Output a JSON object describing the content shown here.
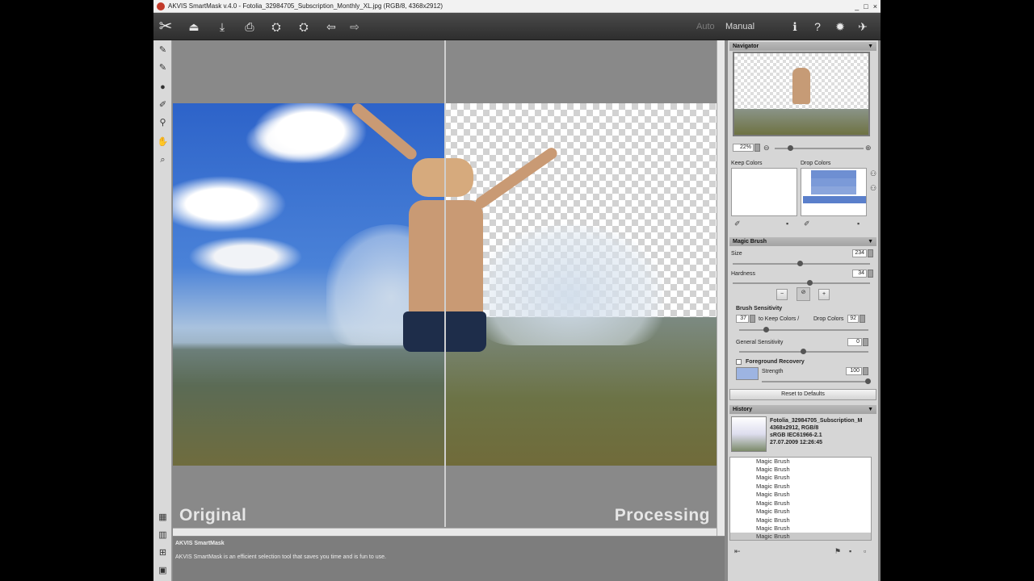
{
  "window": {
    "title": "AKVIS SmartMask v.4.0 - Fotolia_32984705_Subscription_Monthly_XL.jpg (RGB/8, 4368x2912)",
    "controls": [
      "_",
      "□",
      "×"
    ]
  },
  "toolbar": {
    "logo_glyph": "✂",
    "icons": [
      "open-icon",
      "save-icon",
      "print-icon",
      "share-icon",
      "batch-icon",
      "undo-icon",
      "redo-icon"
    ],
    "glyphs": [
      "⏏",
      "⤓",
      "⎙",
      "⛭",
      "⛭",
      "⇦",
      "⇨"
    ],
    "mode_auto": "Auto",
    "mode_manual": "Manual",
    "right_icons": [
      "info-icon",
      "help-icon",
      "settings-icon",
      "feedback-icon"
    ],
    "right_glyphs": [
      "ℹ",
      "?",
      "✹",
      "✈"
    ]
  },
  "left_tools": {
    "icons": [
      "magic-brush-icon",
      "chroma-brush-icon",
      "bucket-icon",
      "pipette-icon",
      "lasso-icon",
      "hand-icon",
      "zoom-icon",
      "view-mode-icon",
      "compare-icon",
      "fit-icon",
      "last-icon"
    ],
    "glyphs": [
      "✎",
      "✎",
      "●",
      "✐",
      "⚲",
      "✋",
      "⌕",
      "▦",
      "▥",
      "⊞",
      "▣"
    ]
  },
  "canvas": {
    "label_original": "Original",
    "label_processing": "Processing"
  },
  "info": {
    "title": "AKVIS SmartMask",
    "text": "AKVIS SmartMask is an efficient selection tool that saves you time and is fun to use."
  },
  "navigator": {
    "title": "Navigator",
    "zoom": "22%"
  },
  "colors": {
    "keep_label": "Keep Colors",
    "drop_label": "Drop Colors",
    "accent": "#6e8fd2"
  },
  "magic_brush": {
    "title": "Magic Brush",
    "size_label": "Size",
    "size_value": "234",
    "hardness_label": "Hardness",
    "hardness_value": "34",
    "sensitivity_title": "Brush Sensitivity",
    "keep_value": "37",
    "keep_label": "to Keep Colors /",
    "drop_label": "Drop Colors",
    "drop_value": "92",
    "general_label": "General Sensitivity",
    "general_value": "0",
    "fg_title": "Foreground Recovery",
    "strength_label": "Strength",
    "strength_value": "100",
    "reset_label": "Reset to Defaults"
  },
  "history": {
    "title": "History",
    "file_name": "Fotolia_32984705_Subscription_M",
    "file_dims": "4368x2912, RGB/8",
    "file_profile": "sRGB IEC61966-2.1",
    "file_date": "27.07.2009 12:26:45",
    "items": [
      "Magic Brush",
      "Magic Brush",
      "Magic Brush",
      "Magic Brush",
      "Magic Brush",
      "Magic Brush",
      "Magic Brush",
      "Magic Brush",
      "Magic Brush",
      "Magic Brush"
    ]
  }
}
